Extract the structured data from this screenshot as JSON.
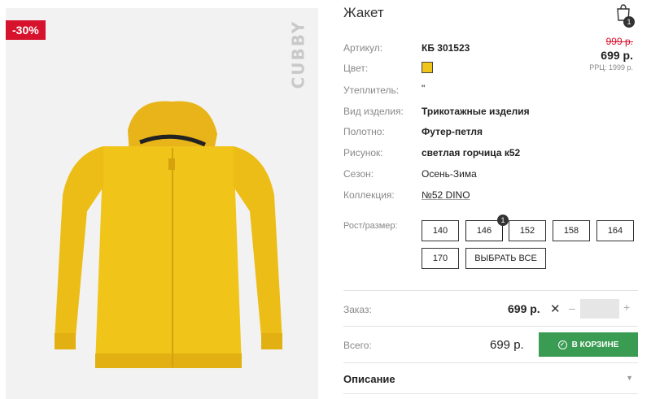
{
  "product": {
    "title": "Жакет",
    "discount": "-30%",
    "brand": "CUBBY",
    "cart_count": "1"
  },
  "attributes": [
    {
      "label": "Артикул:",
      "value": "КБ 301523"
    },
    {
      "label": "Цвет:",
      "value": ""
    },
    {
      "label": "Утеплитель:",
      "value": "\""
    },
    {
      "label": "Вид изделия:",
      "value": "Трикотажные изделия"
    },
    {
      "label": "Полотно:",
      "value": "Футер-петля"
    },
    {
      "label": "Рисунок:",
      "value": "светлая горчица к52"
    },
    {
      "label": "Сезон:",
      "value": "Осень-Зима"
    },
    {
      "label": "Коллекция:",
      "value": "№52 DINO"
    }
  ],
  "color_swatch": "#f0c419",
  "price": {
    "old": "999 р.",
    "new": "699 р.",
    "rrp": "РРЦ: 1999 р."
  },
  "sizes": {
    "label": "Рост/размер:",
    "options": [
      "140",
      "146",
      "152",
      "158",
      "164",
      "170"
    ],
    "selected": "146",
    "selected_count": "1",
    "select_all": "ВЫБРАТЬ ВСЕ"
  },
  "order": {
    "label": "Заказ:",
    "price": "699 р.",
    "remove": "✕",
    "minus": "–",
    "plus": "+",
    "quantity": ""
  },
  "total": {
    "label": "Всего:",
    "price": "699 р.",
    "cart_button": "В КОРЗИНЕ"
  },
  "description": {
    "label": "Описание",
    "chevron": "▼"
  },
  "colors": {
    "discount_red": "#d6122d",
    "cart_green": "#3a9b52",
    "product_yellow": "#f0c419"
  }
}
